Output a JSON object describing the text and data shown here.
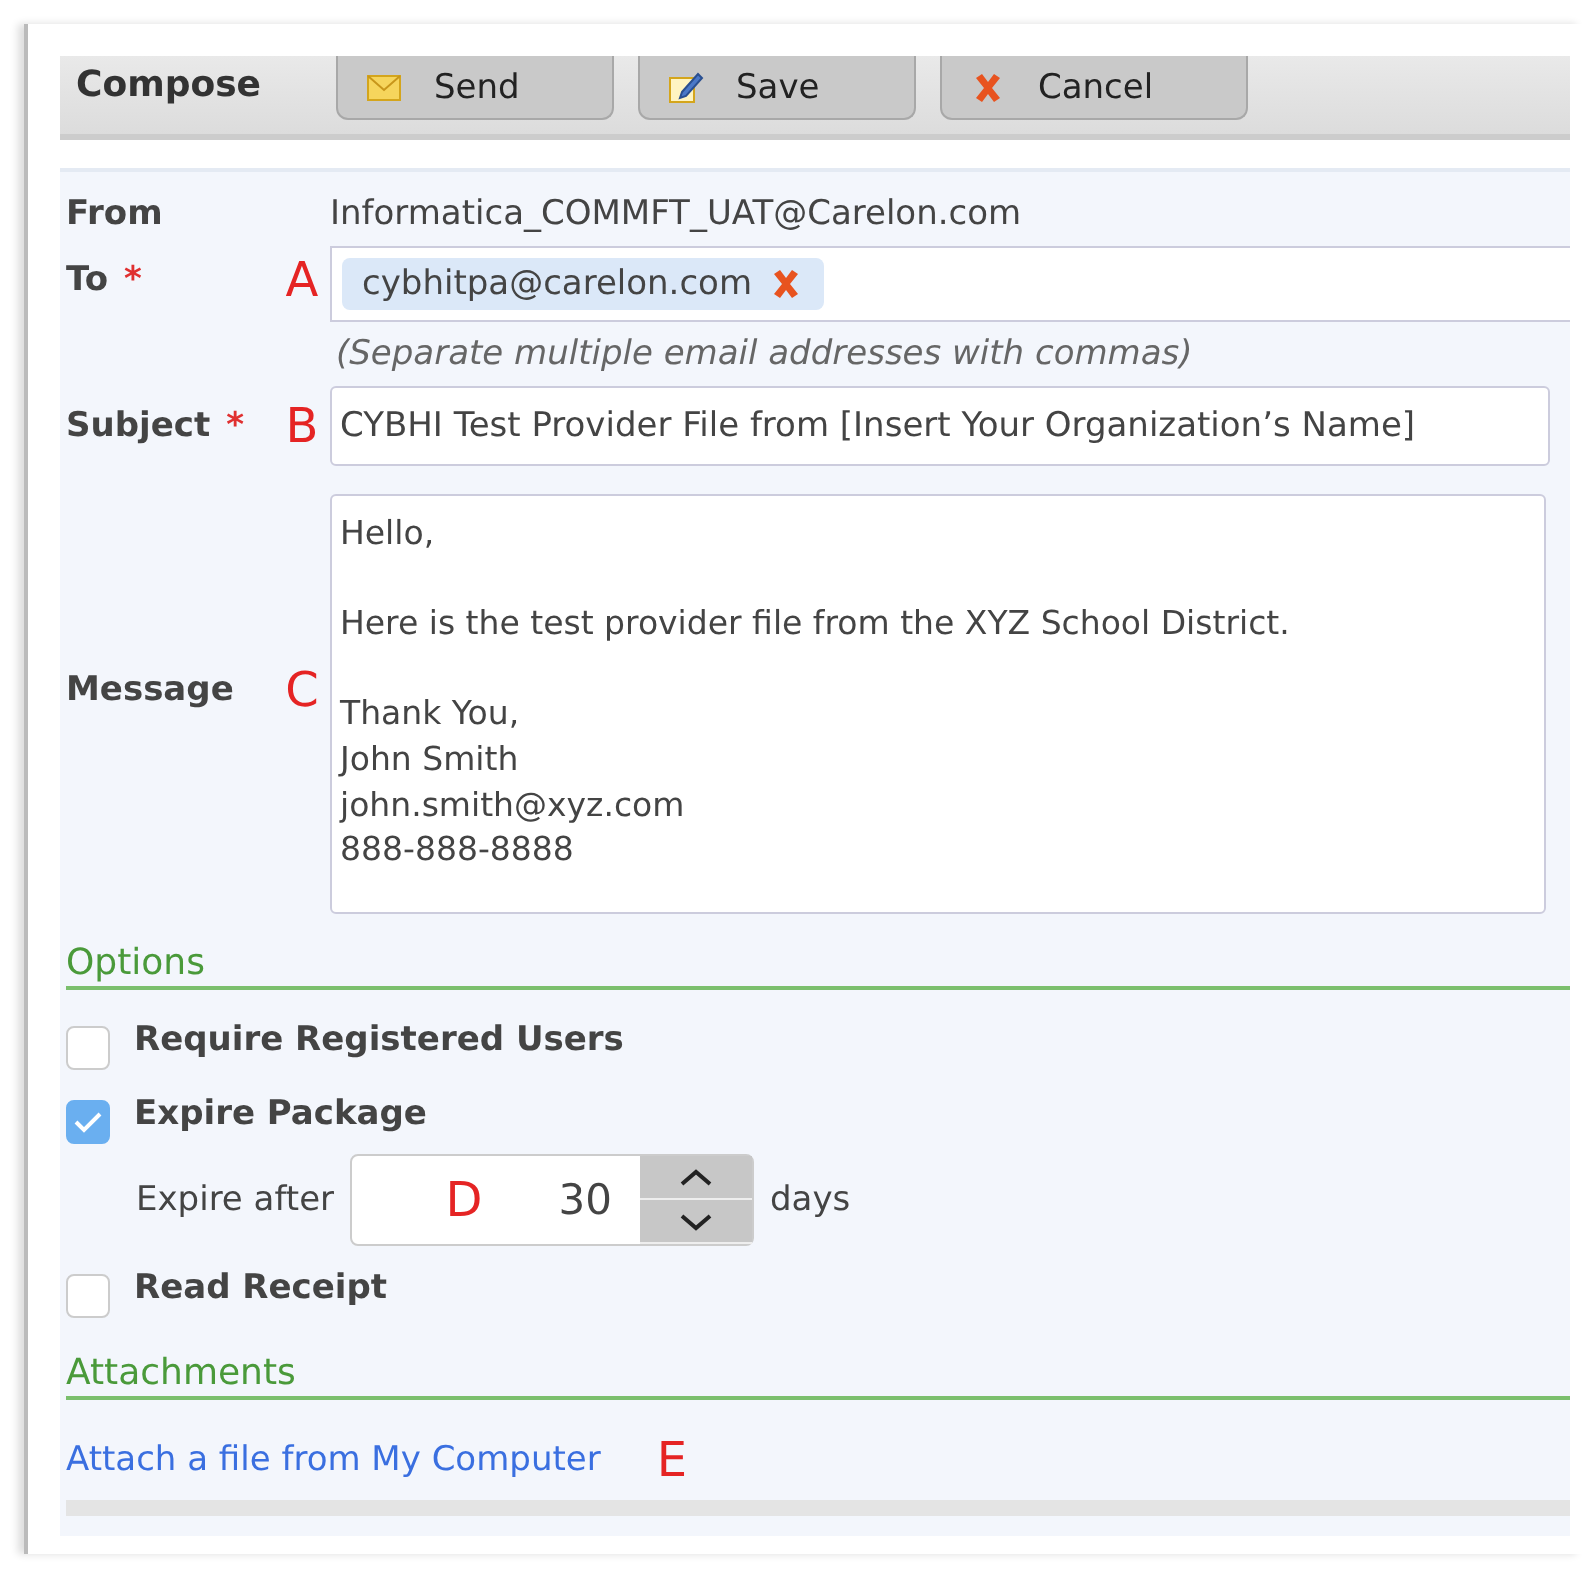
{
  "toolbar": {
    "title": "Compose",
    "buttons": [
      {
        "label": "Send",
        "kind": "send"
      },
      {
        "label": "Save",
        "kind": "save"
      },
      {
        "label": "Cancel",
        "kind": "cancel"
      }
    ]
  },
  "from": {
    "label": "From",
    "value": "Informatica_COMMFT_UAT@Carelon.com"
  },
  "to": {
    "label": "To",
    "required_mark": "*",
    "marker": "A",
    "recipients": [
      {
        "address": "cybhitpa@carelon.com"
      }
    ],
    "hint": "(Separate multiple email addresses with commas)"
  },
  "subject": {
    "label": "Subject",
    "required_mark": "*",
    "marker": "B",
    "value": "CYBHI Test Provider File from [Insert Your Organization’s Name]"
  },
  "message": {
    "label": "Message",
    "marker": "C",
    "value": "Hello,\n\nHere is the test provider file from the XYZ School District.\n\nThank You,\nJohn Smith\njohn.smith@xyz.com\n888-888-8888"
  },
  "options": {
    "title": "Options",
    "items": [
      {
        "kind": "checkbox",
        "label": "Require Registered Users",
        "checked": false
      },
      {
        "kind": "checkbox",
        "label": "Expire Package",
        "checked": true
      },
      {
        "kind": "spinner",
        "label": "Expire after",
        "marker": "D",
        "value": "30",
        "unit": "days"
      },
      {
        "kind": "checkbox",
        "label": "Read Receipt",
        "checked": false
      }
    ]
  },
  "attachments": {
    "title": "Attachments",
    "link": "Attach a file from My Computer",
    "marker": "E"
  }
}
